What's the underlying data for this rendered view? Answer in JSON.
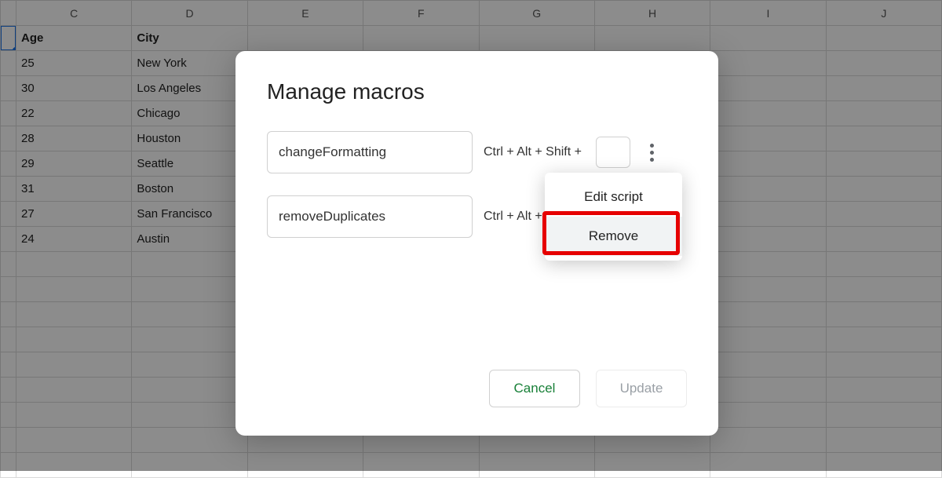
{
  "columns": [
    "",
    "C",
    "D",
    "E",
    "F",
    "G",
    "H",
    "I",
    "J"
  ],
  "headerRow": {
    "c": "Age",
    "d": "City"
  },
  "rows": [
    {
      "c": "25",
      "d": "New York"
    },
    {
      "c": "30",
      "d": "Los Angeles"
    },
    {
      "c": "22",
      "d": "Chicago"
    },
    {
      "c": "28",
      "d": "Houston"
    },
    {
      "c": "29",
      "d": "Seattle"
    },
    {
      "c": "31",
      "d": "Boston"
    },
    {
      "c": "27",
      "d": "San Francisco"
    },
    {
      "c": "24",
      "d": "Austin"
    }
  ],
  "dialog": {
    "title": "Manage macros",
    "shortcut_prefix": "Ctrl + Alt + Shift +",
    "macros": [
      {
        "name": "changeFormatting"
      },
      {
        "name": "removeDuplicates"
      }
    ],
    "cancel": "Cancel",
    "update": "Update"
  },
  "menu": {
    "edit": "Edit script",
    "remove": "Remove"
  }
}
